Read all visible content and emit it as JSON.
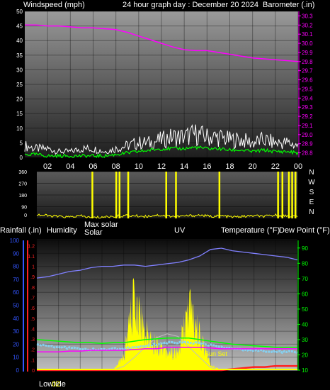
{
  "header": {
    "left": "Windspeed (mph)",
    "center": "24 hour graph day : December 20 2024",
    "right": "Barometer (.in)"
  },
  "mid_labels": {
    "rainfall": "Rainfall (.in)",
    "humidity": "Humidity",
    "max_solar": "Max solar",
    "solar": "Solar",
    "uv": "UV",
    "temperature": "Temperature (°F)",
    "dew_point": "Dew Point (°F)"
  },
  "footer": {
    "lowtide": "Lowtide",
    "sun_set": "Sun Set"
  },
  "colors": {
    "wind_gust": "#ffffff",
    "wind_avg": "#00ff00",
    "barometer": "#ff00ff",
    "direction": "#ffff00",
    "rain_axis": "#3355ff",
    "rain": "#ff2020",
    "humidity": "#8080ff",
    "solar": "#ffff00",
    "max_solar": "#c0c0c0",
    "temperature": "#00ff00",
    "dew_point": "#ff00ff",
    "apparent": "#80d8ff"
  },
  "chart_data": [
    {
      "type": "line",
      "title": "24 hour graph day : December 20 2024",
      "xlabel": "",
      "x_ticks": [
        "02",
        "04",
        "06",
        "08",
        "10",
        "12",
        "14",
        "16",
        "18",
        "20",
        "22",
        "00"
      ],
      "y_left_label": "Windspeed (mph)",
      "y_left_ticks": [
        0,
        5,
        10,
        15,
        20,
        25,
        30,
        35,
        40,
        45,
        50
      ],
      "ylim_left": [
        0,
        50
      ],
      "y_right_label": "Barometer (.in)",
      "y_right_ticks": [
        28.8,
        28.9,
        29.0,
        29.1,
        29.2,
        29.3,
        29.4,
        29.5,
        29.6,
        29.7,
        29.8,
        29.9,
        30.0,
        30.1,
        30.2,
        30.3
      ],
      "ylim_right": [
        28.75,
        30.35
      ],
      "x_hours": [
        0,
        1,
        2,
        3,
        4,
        5,
        6,
        7,
        8,
        9,
        10,
        11,
        12,
        13,
        14,
        15,
        16,
        17,
        18,
        19,
        20,
        21,
        22,
        23,
        24
      ],
      "series": [
        {
          "name": "Windspeed (mph)",
          "axis": "left",
          "values": [
            4,
            3,
            3,
            2,
            2,
            3,
            3,
            2,
            3,
            4,
            5,
            5,
            6,
            7,
            7,
            8,
            7,
            7,
            6,
            6,
            5,
            6,
            5,
            5,
            4
          ]
        },
        {
          "name": "",
          "axis": "left",
          "values": [
            1,
            1,
            0.5,
            0.5,
            0.5,
            0.5,
            0.5,
            0.5,
            1,
            1.5,
            2,
            2.5,
            3,
            3,
            3,
            3.5,
            3,
            3,
            2.5,
            2.5,
            2,
            2.5,
            2,
            2,
            1.5
          ]
        },
        {
          "name": "Barometer (.in)",
          "axis": "right",
          "values": [
            30.2,
            30.2,
            30.19,
            30.19,
            30.18,
            30.17,
            30.17,
            30.16,
            30.15,
            30.12,
            30.08,
            30.04,
            30.0,
            29.96,
            29.93,
            29.92,
            29.92,
            29.9,
            29.88,
            29.86,
            29.84,
            29.83,
            29.82,
            29.81,
            29.8
          ]
        }
      ]
    },
    {
      "type": "line",
      "y_ticks": [
        0,
        90,
        180,
        270,
        360
      ],
      "ylim": [
        0,
        360
      ],
      "direction_labels": [
        "N",
        "W",
        "S",
        "E",
        "N"
      ],
      "x_hours": [
        0,
        1,
        2,
        3,
        4,
        5,
        6,
        7,
        8,
        9,
        10,
        11,
        12,
        13,
        14,
        15,
        16,
        17,
        18,
        19,
        20,
        21,
        22,
        23,
        24
      ],
      "series": [
        {
          "name": "",
          "values": [
            30,
            20,
            15,
            10,
            20,
            5,
            10,
            15,
            20,
            20,
            15,
            25,
            20,
            15,
            20,
            25,
            15,
            20,
            10,
            15,
            20,
            15,
            25,
            20,
            15
          ]
        }
      ],
      "spikes_hours": [
        5.1,
        7.3,
        7.6,
        8.4,
        11.9,
        12.8,
        16.8,
        22.2,
        22.6,
        23.2,
        23.5,
        23.8
      ]
    },
    {
      "type": "area",
      "x_hours": [
        0,
        1,
        2,
        3,
        4,
        5,
        6,
        7,
        8,
        9,
        10,
        11,
        12,
        13,
        14,
        15,
        16,
        17,
        18,
        19,
        20,
        21,
        22,
        23,
        24
      ],
      "y_left_ticks": [
        0,
        10,
        20,
        30,
        40,
        50,
        60,
        70,
        80,
        90,
        100
      ],
      "ylim_left": [
        0,
        100
      ],
      "rain_ticks": [
        0,
        0.1,
        0.2,
        0.3,
        0.4,
        0.5,
        0.6,
        0.7,
        0.8,
        0.9,
        1,
        1.1,
        1.2
      ],
      "y_right_ticks": [
        10,
        20,
        30,
        40,
        50,
        60,
        70,
        80,
        90
      ],
      "ylim_right": [
        10,
        95
      ],
      "series": [
        {
          "name": "Humidity",
          "axis": "left",
          "values": [
            71,
            72,
            74,
            76,
            77,
            79,
            80,
            80,
            81,
            81,
            80,
            81,
            82,
            83,
            85,
            88,
            93,
            94,
            92,
            91,
            90,
            89,
            88,
            87,
            85
          ]
        },
        {
          "name": "Solar",
          "axis": "left",
          "values": [
            0,
            0,
            0,
            0,
            0,
            0,
            0,
            0,
            10,
            55,
            28,
            20,
            15,
            12,
            48,
            26,
            4,
            0,
            0,
            0,
            0,
            0,
            0,
            0,
            0
          ]
        },
        {
          "name": "Max solar",
          "axis": "left",
          "values": [
            0,
            0,
            0,
            0,
            0,
            0,
            0,
            0,
            3,
            10,
            18,
            25,
            28,
            26,
            18,
            10,
            2,
            0,
            0,
            0,
            0,
            0,
            0,
            0,
            0
          ]
        },
        {
          "name": "Temperature (°F)",
          "axis": "right",
          "values": [
            30,
            29.5,
            29,
            28.5,
            28,
            28,
            27.5,
            28,
            28,
            29,
            30,
            30.5,
            31,
            31,
            31,
            30,
            29,
            28,
            27,
            26.5,
            26,
            25.5,
            25,
            25,
            25
          ]
        },
        {
          "name": "Dew Point (°F)",
          "axis": "right",
          "values": [
            22,
            22,
            22,
            22.5,
            22.5,
            23,
            23,
            23,
            23,
            23.5,
            24,
            24,
            25,
            25,
            25,
            25,
            24.5,
            24,
            24,
            24,
            24,
            24,
            24,
            24,
            24
          ]
        },
        {
          "name": "",
          "axis": "right",
          "values": [
            27,
            26,
            25,
            24.5,
            24,
            23.5,
            23.5,
            24,
            24,
            25,
            26,
            27,
            28,
            28,
            28,
            27.5,
            26.5,
            25,
            24,
            23.5,
            23,
            22.5,
            22,
            22,
            22
          ]
        },
        {
          "name": "Rainfall (.in)",
          "axis": "rain",
          "values": [
            0,
            0,
            0,
            0,
            0,
            0,
            0,
            0,
            0,
            0,
            0,
            0,
            0,
            0,
            0,
            0,
            0,
            0,
            0.01,
            0.02,
            0.03,
            0.03,
            0.04,
            0.04,
            0.04
          ]
        }
      ]
    }
  ]
}
